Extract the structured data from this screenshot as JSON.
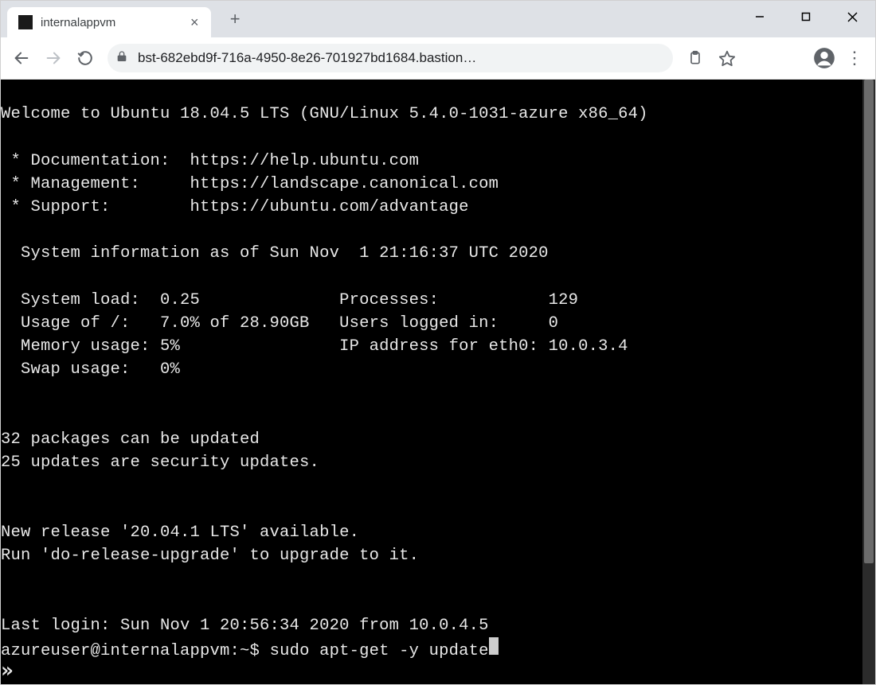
{
  "window": {
    "tab_title": "internalappvm",
    "url_display": "bst-682ebd9f-716a-4950-8e26-701927bd1684.bastion…"
  },
  "icons": {
    "new_tab": "+",
    "tab_close": "×",
    "more_menu": "⋮"
  },
  "motd": {
    "welcome": "Welcome to Ubuntu 18.04.5 LTS (GNU/Linux 5.4.0-1031-azure x86_64)",
    "links": {
      "doc_label": " * Documentation:  https://help.ubuntu.com",
      "mgmt_label": " * Management:     https://landscape.canonical.com",
      "sup_label": " * Support:        https://ubuntu.com/advantage"
    },
    "sysinfo_header": "  System information as of Sun Nov  1 21:16:37 UTC 2020",
    "sysinfo_rows": [
      "  System load:  0.25              Processes:           129",
      "  Usage of /:   7.0% of 28.90GB   Users logged in:     0",
      "  Memory usage: 5%                IP address for eth0: 10.0.3.4",
      "  Swap usage:   0%"
    ],
    "updates_line1": "32 packages can be updated",
    "updates_line2": "25 updates are security updates.",
    "release_line1": "New release '20.04.1 LTS' available.",
    "release_line2": "Run 'do-release-upgrade' to upgrade to it.",
    "last_login": "Last login: Sun Nov 1 20:56:34 2020 from 10.0.4.5"
  },
  "shell": {
    "ps1": "azureuser@internalappvm:~$ ",
    "command": "sudo apt-get -y update"
  },
  "expand_hint": "»"
}
